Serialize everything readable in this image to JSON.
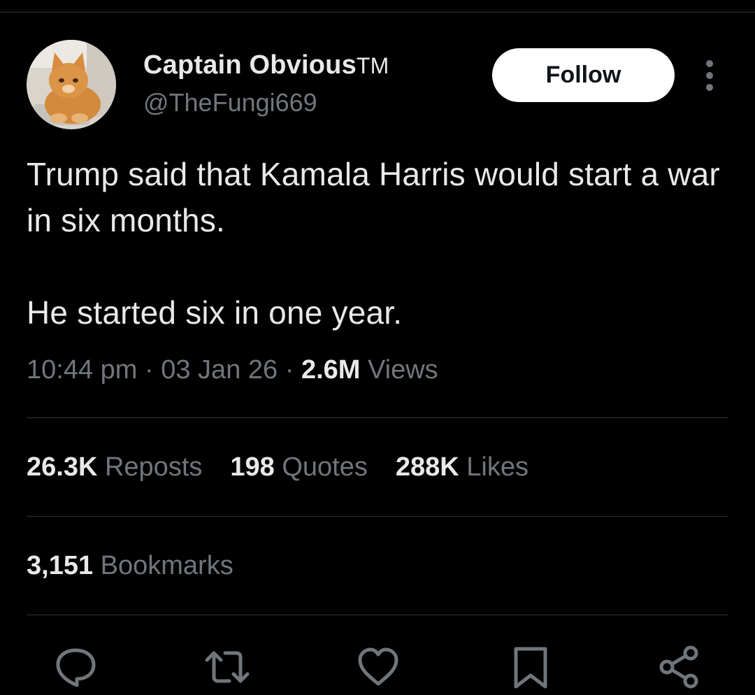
{
  "user": {
    "display_name": "Captain Obvious",
    "name_suffix": "TM",
    "handle": "@TheFungi669"
  },
  "follow_label": "Follow",
  "tweet": {
    "paragraphs": [
      "Trump said that Kamala Harris would start a war in six months.",
      "He started six in one year."
    ]
  },
  "meta": {
    "time": "10:44 pm",
    "sep": "·",
    "date": "03 Jan 26",
    "views_count": "2.6M",
    "views_label": "Views"
  },
  "stats": {
    "reposts": {
      "count": "26.3K",
      "label": "Reposts"
    },
    "quotes": {
      "count": "198",
      "label": "Quotes"
    },
    "likes": {
      "count": "288K",
      "label": "Likes"
    },
    "bookmarks": {
      "count": "3,151",
      "label": "Bookmarks"
    }
  },
  "actions": [
    "reply-icon",
    "repost-icon",
    "like-icon",
    "bookmark-icon",
    "share-icon"
  ],
  "colors": {
    "background": "#000000",
    "text_primary": "#e7e9ea",
    "text_secondary": "#71767b",
    "divider": "#2f3336",
    "follow_bg": "#ffffff"
  }
}
